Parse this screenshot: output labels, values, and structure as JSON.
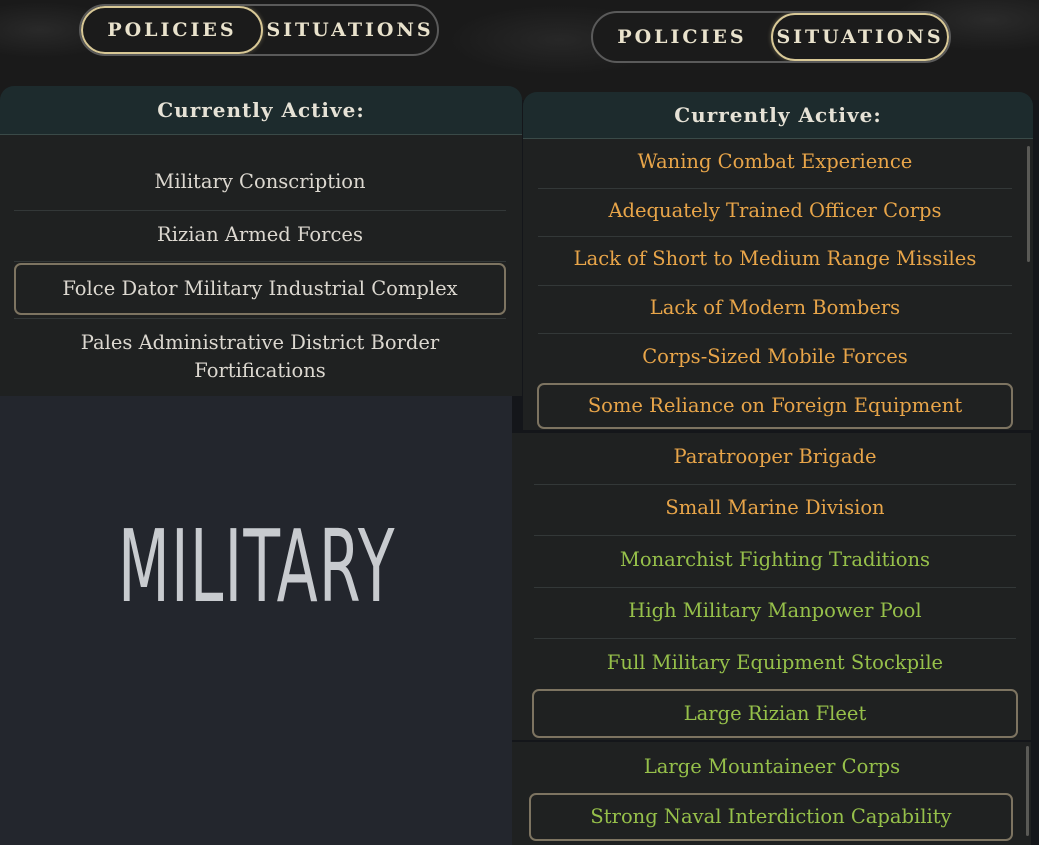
{
  "left": {
    "tabs": [
      {
        "label": "POLICIES",
        "active": true
      },
      {
        "label": "SITUATIONS",
        "active": false
      }
    ],
    "header": "Currently Active:",
    "items": [
      {
        "label": "Military Conscription",
        "highlighted": false
      },
      {
        "label": "Rizian Armed Forces",
        "highlighted": false
      },
      {
        "label": "Folce Dator Military Industrial Complex",
        "highlighted": true
      },
      {
        "label": "Pales Administrative District Border Fortifications",
        "highlighted": false
      }
    ]
  },
  "right": {
    "tabs": [
      {
        "label": "POLICIES",
        "active": false
      },
      {
        "label": "SITUATIONS",
        "active": true
      }
    ],
    "header": "Currently Active:",
    "orange_items": [
      "Waning Combat Experience",
      "Adequately Trained Officer Corps",
      "Lack of Short to Medium Range Missiles",
      "Lack of Modern Bombers",
      "Corps-Sized Mobile Forces",
      "Some Reliance on Foreign Equipment",
      "Paratrooper Brigade",
      "Small Marine Division"
    ],
    "green_items": [
      "Monarchist Fighting Traditions",
      "High Military Manpower Pool",
      "Full Military Equipment Stockpile",
      "Large Rizian Fleet",
      "Large Mountaineer Corps",
      "Strong Naval Interdiction Capability"
    ]
  },
  "banner": "MILITARY",
  "colors": {
    "negative": "#e8a549",
    "positive": "#96c04a",
    "neutral": "#dcd8d0",
    "highlight_border": "#7d7461"
  }
}
